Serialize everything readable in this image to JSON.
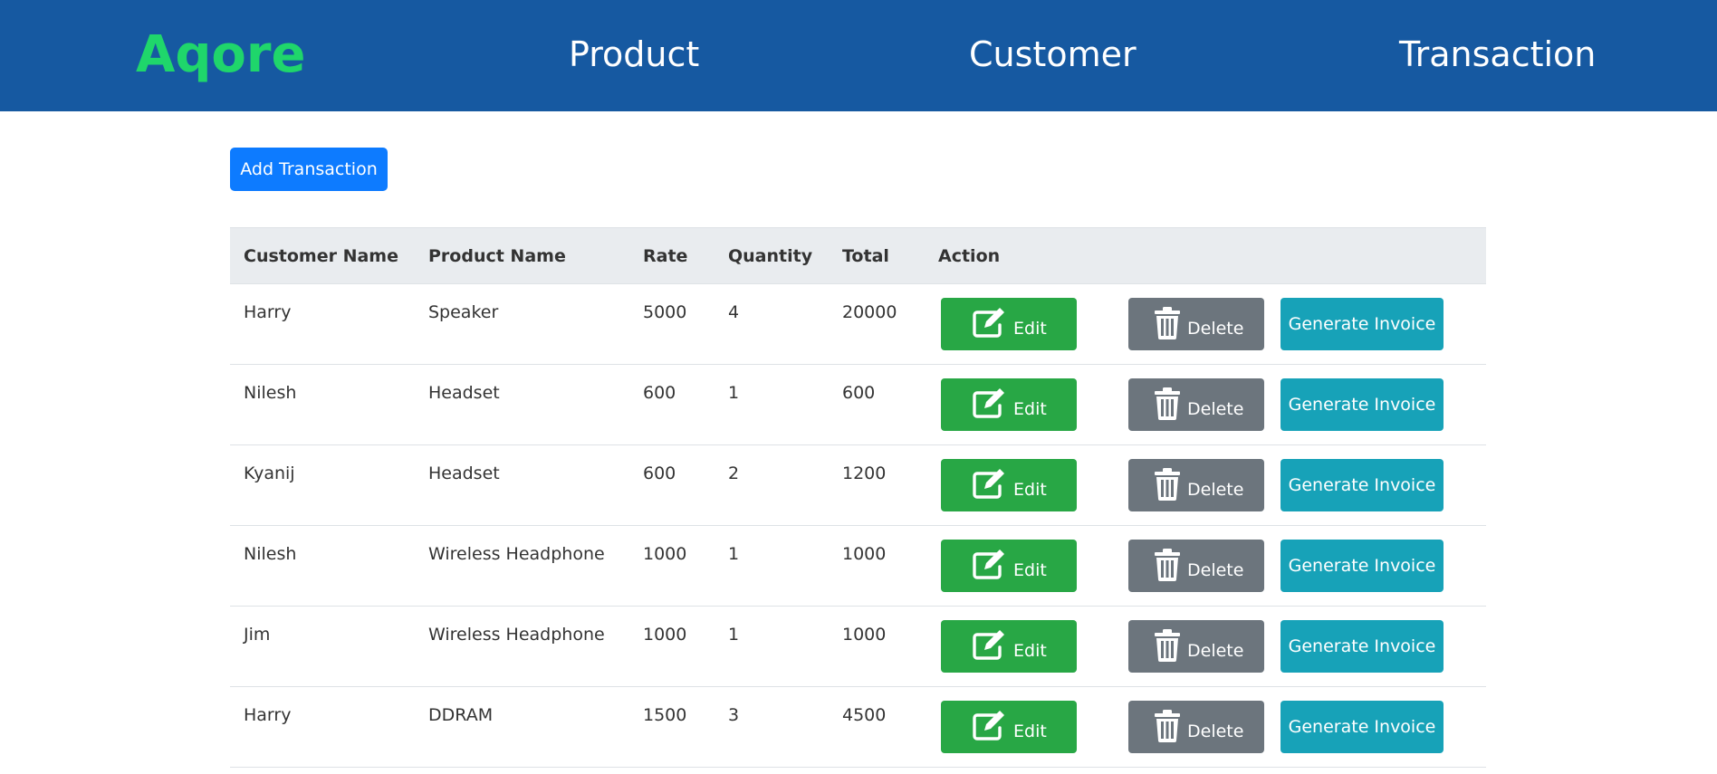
{
  "nav": {
    "brand": "Aqore",
    "links": [
      "Product",
      "Customer",
      "Transaction"
    ]
  },
  "toolbar": {
    "add_label": "Add Transaction"
  },
  "table": {
    "headers": [
      "Customer Name",
      "Product Name",
      "Rate",
      "Quantity",
      "Total",
      "Action"
    ],
    "rows": [
      {
        "customer": "Harry",
        "product": "Speaker",
        "rate": "5000",
        "quantity": "4",
        "total": "20000"
      },
      {
        "customer": "Nilesh",
        "product": "Headset",
        "rate": "600",
        "quantity": "1",
        "total": "600"
      },
      {
        "customer": "Kyanij",
        "product": "Headset",
        "rate": "600",
        "quantity": "2",
        "total": "1200"
      },
      {
        "customer": "Nilesh",
        "product": "Wireless Headphone",
        "rate": "1000",
        "quantity": "1",
        "total": "1000"
      },
      {
        "customer": "Jim",
        "product": "Wireless Headphone",
        "rate": "1000",
        "quantity": "1",
        "total": "1000"
      },
      {
        "customer": "Harry",
        "product": "DDRAM",
        "rate": "1500",
        "quantity": "3",
        "total": "4500"
      }
    ],
    "actions": {
      "edit_label": "Edit",
      "delete_label": "Delete",
      "invoice_label": "Generate Invoice",
      "edit_icon": "edit-icon",
      "delete_icon": "trash-icon"
    }
  },
  "colors": {
    "navbar": "#1659a1",
    "brand": "#1fd66b",
    "primary": "#0d7bff",
    "edit": "#28a745",
    "delete": "#6c757d",
    "invoice": "#17a2b8",
    "table_header": "#e9ecef"
  }
}
